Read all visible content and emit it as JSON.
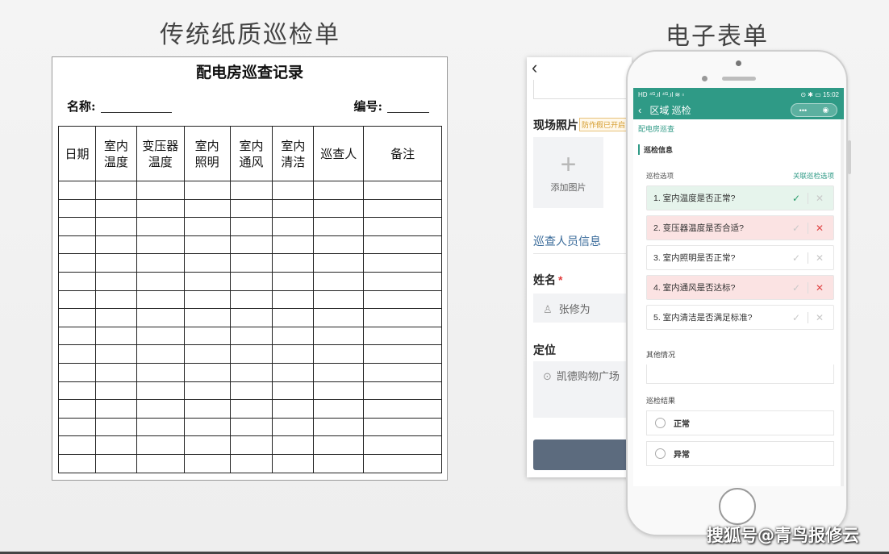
{
  "headings": {
    "left": "传统纸质巡检单",
    "right": "电子表单"
  },
  "paper_form": {
    "title": "配电房巡查记录",
    "name_label": "名称:",
    "number_label": "编号:",
    "columns": [
      [
        "日期"
      ],
      [
        "室内",
        "温度"
      ],
      [
        "变压器",
        "温度"
      ],
      [
        "室内",
        "照明"
      ],
      [
        "室内",
        "通风"
      ],
      [
        "室内",
        "清洁"
      ],
      [
        "巡查人"
      ],
      [
        "备注"
      ]
    ],
    "blank_rows": 16
  },
  "background_screen": {
    "back_icon": "chevron-left-icon",
    "photo_label": "现场照片",
    "anti_fake_tag": "防作假已开启",
    "add_photo": "添加图片",
    "plus_glyph": "+",
    "inspector_section": "巡查人员信息",
    "name_label": "姓名",
    "required_mark": "*",
    "name_value": "张修为",
    "location_label": "定位",
    "location_value": "凯德购物广场"
  },
  "phone": {
    "status_left": "HD ⁴ᴳ.ıl ⁴ᴳ.ıl ≋ ▫",
    "status_time": "⊙ ✱ ▭ 15:02",
    "nav_title": "区域 巡检",
    "capsule_more": "•••",
    "capsule_close": "◉",
    "breadcrumb": "配电房巡查",
    "section_title": "巡检信息",
    "options_label": "巡检选项",
    "options_link": "关联巡检选项",
    "options": [
      {
        "text": "1. 室内温度是否正常?",
        "state": "ok"
      },
      {
        "text": "2. 变压器温度是否合适?",
        "state": "bad"
      },
      {
        "text": "3. 室内照明是否正常?",
        "state": "none"
      },
      {
        "text": "4. 室内通风是否达标?",
        "state": "bad"
      },
      {
        "text": "5. 室内清洁是否满足标准?",
        "state": "none"
      }
    ],
    "check_glyph": "✓",
    "cross_glyph": "✕",
    "other_label": "其他情况",
    "result_label": "巡检结果",
    "result_options": [
      "正常",
      "异常"
    ]
  },
  "watermark": "搜狐号@青鸟报修云",
  "colors": {
    "accent": "#2f9a86",
    "ok_bg": "#e6f4ec",
    "bad_bg": "#fbe3e3",
    "submit": "#5c6b7e"
  }
}
